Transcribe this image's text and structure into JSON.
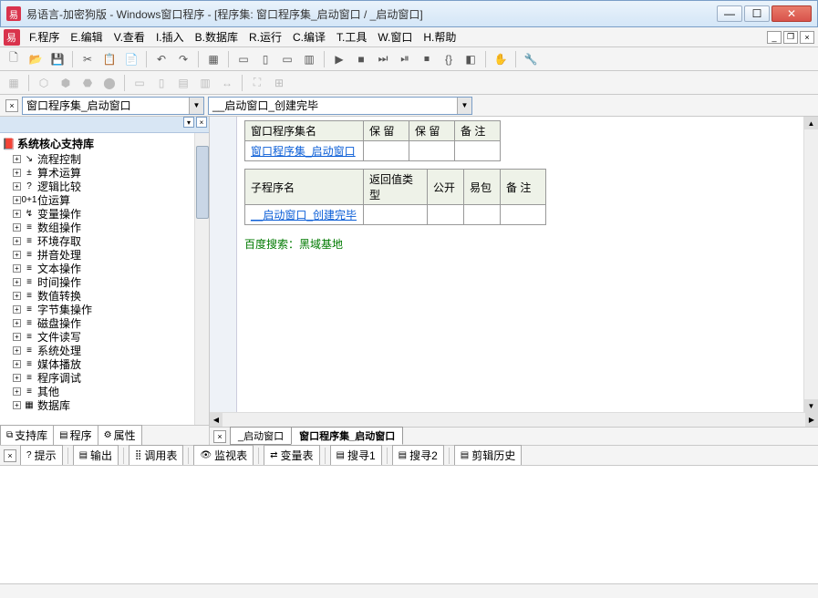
{
  "title": "易语言-加密狗版 - Windows窗口程序 - [程序集: 窗口程序集_启动窗口 / _启动窗口]",
  "menu": [
    "F.程序",
    "E.编辑",
    "V.查看",
    "I.插入",
    "B.数据库",
    "R.运行",
    "C.编译",
    "T.工具",
    "W.窗口",
    "H.帮助"
  ],
  "combo1": "窗口程序集_启动窗口",
  "combo2": "__启动窗口_创建完毕",
  "tree": {
    "root": "系统核心支持库",
    "items": [
      {
        "icon": "↘",
        "label": "流程控制"
      },
      {
        "icon": "±",
        "label": "算术运算"
      },
      {
        "icon": "?",
        "label": "逻辑比较"
      },
      {
        "icon": "0+1",
        "label": "位运算"
      },
      {
        "icon": "↯",
        "label": "变量操作"
      },
      {
        "icon": "≡",
        "label": "数组操作"
      },
      {
        "icon": "≡",
        "label": "环境存取"
      },
      {
        "icon": "≡",
        "label": "拼音处理"
      },
      {
        "icon": "≡",
        "label": "文本操作"
      },
      {
        "icon": "≡",
        "label": "时间操作"
      },
      {
        "icon": "≡",
        "label": "数值转换"
      },
      {
        "icon": "≡",
        "label": "字节集操作"
      },
      {
        "icon": "≡",
        "label": "磁盘操作"
      },
      {
        "icon": "≡",
        "label": "文件读写"
      },
      {
        "icon": "≡",
        "label": "系统处理"
      },
      {
        "icon": "≡",
        "label": "媒体播放"
      },
      {
        "icon": "≡",
        "label": "程序调试"
      },
      {
        "icon": "≡",
        "label": "其他"
      },
      {
        "icon": "▦",
        "label": "数据库"
      }
    ]
  },
  "lib_tabs": [
    {
      "icon": "⧉",
      "label": "支持库"
    },
    {
      "icon": "▤",
      "label": "程序"
    },
    {
      "icon": "⚙",
      "label": "属性"
    }
  ],
  "table1": {
    "headers": [
      "窗口程序集名",
      "保 留",
      "保 留",
      "备 注"
    ],
    "row": [
      "窗口程序集_启动窗口",
      "",
      "",
      ""
    ]
  },
  "table2": {
    "headers": [
      "子程序名",
      "返回值类型",
      "公开",
      "易包",
      "备 注"
    ],
    "row": [
      "__启动窗口_创建完毕",
      "",
      "",
      "",
      ""
    ]
  },
  "comment": "百度搜索：黑域基地",
  "editor_tabs": [
    "_启动窗口",
    "窗口程序集_启动窗口"
  ],
  "output_tabs": [
    {
      "icon": "?",
      "label": "提示"
    },
    {
      "icon": "▤",
      "label": "输出"
    },
    {
      "icon": "⣿",
      "label": "调用表"
    },
    {
      "icon": "👁",
      "label": "监视表"
    },
    {
      "icon": "⇄",
      "label": "变量表"
    },
    {
      "icon": "▤",
      "label": "搜寻1"
    },
    {
      "icon": "▤",
      "label": "搜寻2"
    },
    {
      "icon": "▤",
      "label": "剪辑历史"
    }
  ],
  "toolbar1_icons": [
    "🗋",
    "📂",
    "💾",
    "",
    "✂",
    "📋",
    "📄",
    "",
    "↶",
    "↷",
    "",
    "▦",
    "",
    "▭",
    "▯",
    "▭",
    "▥",
    "",
    "▶",
    "■",
    "⏭",
    "⏯",
    "⏹",
    "{}",
    "◧",
    "",
    "✋",
    "",
    "🔧"
  ],
  "toolbar2_icons": [
    "▦",
    "",
    "⬡",
    "⬢",
    "⬣",
    "⬤",
    "",
    "▭",
    "▯",
    "▤",
    "▥",
    "↔",
    "",
    "⛶",
    "⊞"
  ]
}
